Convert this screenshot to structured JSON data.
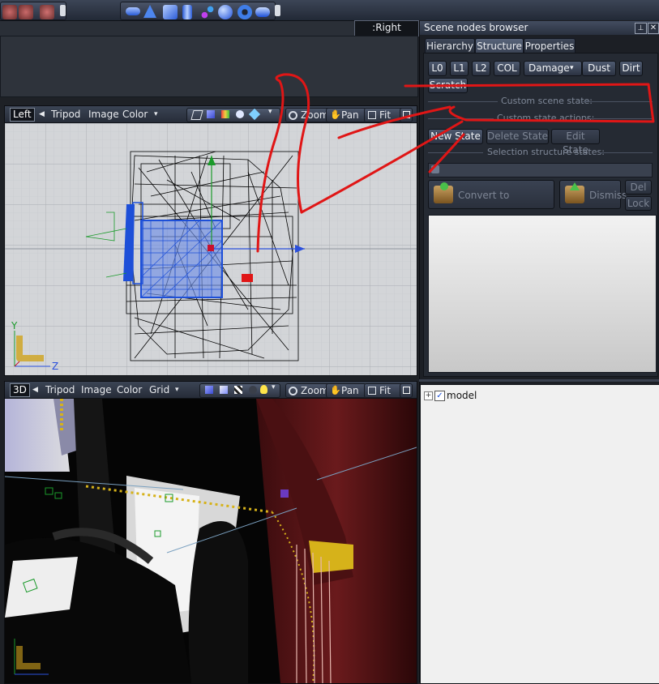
{
  "top_toolbar": {
    "icons": [
      "undo-icon",
      "redo-icon",
      "grid-icon",
      "cube-icon",
      "cone-icon",
      "box-icon",
      "cylinder-icon",
      "bone-icon",
      "sphere-icon",
      "torus-icon",
      "capsule-icon"
    ]
  },
  "right_button_label": ":Right button",
  "browser": {
    "title": "Scene nodes browser",
    "tabs": [
      "Hierarchy",
      "Structure",
      "Properties"
    ],
    "lod_buttons": [
      "L0",
      "L1",
      "L2",
      "COL"
    ],
    "damage_label": "Damage",
    "dust_label": "Dust",
    "dirt_label": "Dirt",
    "scratch_label": "Scratch",
    "custom_scene_state": "Custom scene state:",
    "custom_state_actions": "Custom state actions:",
    "new_state": "New State",
    "delete_state": "Delete State",
    "edit_state": "Edit State",
    "selection_structure_states": "Selection structure states:",
    "convert_to_compound": "Convert to Compound",
    "dismiss": "Dismiss",
    "del": "Del",
    "lock": "Lock"
  },
  "tree": {
    "root_label": "model"
  },
  "viewport_left": {
    "name": "Left",
    "menu": [
      "Tripod",
      "Image",
      "Color"
    ],
    "zoom": "Zoom",
    "pan": "Pan",
    "fit": "Fit",
    "axis_y": "Y",
    "axis_z": "Z"
  },
  "viewport_3d": {
    "name": "3D",
    "menu": [
      "Tripod",
      "Image",
      "Color",
      "Grid"
    ],
    "zoom": "Zoom",
    "pan": "Pan",
    "fit": "Fit"
  },
  "colors": {
    "accent": "#5b6a86",
    "annotation": "#e01616",
    "selection": "#1d4fd8"
  }
}
